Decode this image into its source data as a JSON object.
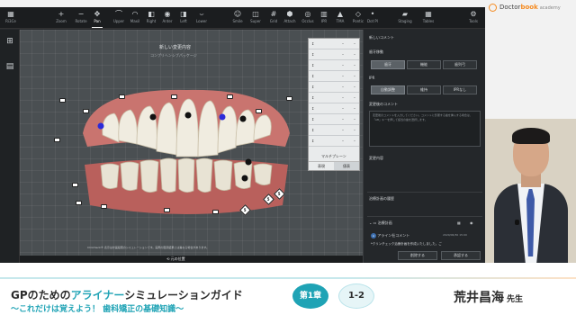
{
  "toolbar": {
    "left_item": {
      "icon": "app-icon",
      "label": "Ri3Ce"
    },
    "buttons": [
      {
        "icon": "plus-icon",
        "label": "Zoom"
      },
      {
        "icon": "minus-icon",
        "label": "Rotate"
      },
      {
        "icon": "move-icon",
        "label": "Pan",
        "active": true
      },
      {
        "icon": "upper-jaw-icon",
        "label": "Upper"
      },
      {
        "icon": "maxilla-icon",
        "label": "Maxil"
      },
      {
        "icon": "right-icon",
        "label": "Right"
      },
      {
        "icon": "anterior-icon",
        "label": "Anter"
      },
      {
        "icon": "left-icon",
        "label": "Left"
      },
      {
        "icon": "lower-jaw-icon",
        "label": "Lower"
      },
      {
        "icon": "smile-icon",
        "label": "Smile"
      },
      {
        "icon": "superimpose-icon",
        "label": "Super"
      },
      {
        "icon": "grid-icon",
        "label": "Grid"
      },
      {
        "icon": "attachment-icon",
        "label": "Attach"
      },
      {
        "icon": "occlusion-icon",
        "label": "Occlus"
      },
      {
        "icon": "ipr-icon",
        "label": "IPR"
      },
      {
        "icon": "tma-icon",
        "label": "TMA"
      },
      {
        "icon": "pontic-icon",
        "label": "Pontic"
      },
      {
        "icon": "dot-icon",
        "label": "Dot Pl"
      },
      {
        "icon": "folder-icon",
        "label": "Staging"
      },
      {
        "icon": "table-icon",
        "label": "Tables"
      },
      {
        "icon": "gear-icon",
        "label": "Tools"
      }
    ]
  },
  "leftbar": [
    {
      "icon": "grid-view-icon",
      "label": ""
    },
    {
      "icon": "panel-icon",
      "label": ""
    }
  ],
  "viewport": {
    "title": "新しい変更内容",
    "subtitle": "コンプリヘンシブパッケージ",
    "disclaimer": "ClinCheck®  表示は計画段階のシミュレーションです。実際の臨床結果とは異なる場合があります。",
    "original_position": "元の位置"
  },
  "move_panel": {
    "rows": [
      "",
      "",
      "",
      "",
      "",
      "",
      "",
      "",
      "",
      ""
    ],
    "dash": "–",
    "label": "マルチプレーン",
    "tabs": [
      "表現",
      "値表"
    ]
  },
  "right_panel": {
    "new_comment": "新しいコメント",
    "tooth_movement": "歯牙移動",
    "movement_options": [
      "歯牙",
      "機能",
      "歯列弓"
    ],
    "ipr": "IPR",
    "ipr_options": [
      "自動調整",
      "維持",
      "IPRなし"
    ],
    "change_comment": "変更後のコメント",
    "comment_placeholder": "変更後のコメントを入力してください。コメントに影響する歯を挿入する場合は、「AB」キーを押して該当の歯を選択します。",
    "change_content": "変更内容",
    "treatment_history": "治療計画の履歴",
    "plan_label": "治療計画",
    "plan_icon": "A",
    "plan_author": "アライン社コメント",
    "plan_date": "2020/06/30 15:00",
    "plan_note": "*クリンチェック治療計画を作成いたしました。ご",
    "delete_button": "削除する",
    "approve_button": "承認する"
  },
  "logo": {
    "brand_prefix": "Doctor",
    "brand_suffix": "book",
    "sub": "academy"
  },
  "lower_third": {
    "title_prefix": "GPのための",
    "title_highlight": "アライナー",
    "title_suffix": "シミュレーションガイド",
    "subtitle": "～これだけは覚えよう！ 歯科矯正の基礎知識～",
    "chapter": "第1章",
    "episode": "1-2",
    "lecturer": "荒井昌海",
    "honorific": "先生"
  },
  "colors": {
    "accent": "#1fa3b5",
    "brand_orange": "#f58a1f",
    "app_bg": "#26292c"
  }
}
